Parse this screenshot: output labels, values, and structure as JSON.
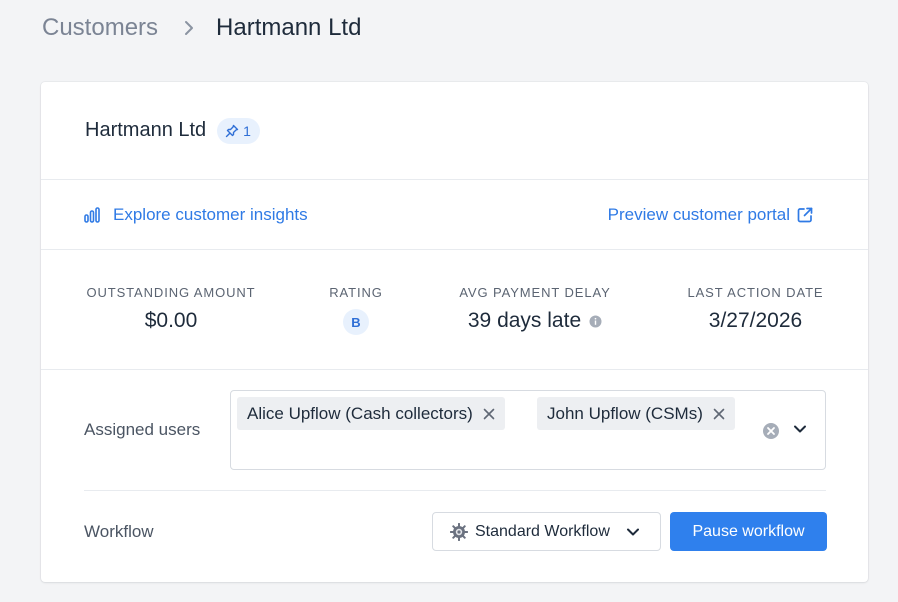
{
  "breadcrumb": {
    "parent": "Customers",
    "current": "Hartmann Ltd"
  },
  "customer": {
    "name": "Hartmann Ltd",
    "pin_count": "1"
  },
  "links": {
    "insights": "Explore customer insights",
    "portal": "Preview customer portal"
  },
  "stats": {
    "outstanding_label": "OUTSTANDING AMOUNT",
    "outstanding_value": "$0.00",
    "rating_label": "RATING",
    "rating_value": "B",
    "delay_label": "AVG PAYMENT DELAY",
    "delay_value": "39 days late",
    "last_action_label": "LAST ACTION DATE",
    "last_action_value": "3/27/2026"
  },
  "assigned": {
    "label": "Assigned users",
    "users": [
      "Alice Upflow (Cash collectors)",
      "John Upflow (CSMs)"
    ]
  },
  "workflow": {
    "label": "Workflow",
    "selected": "Standard Workflow",
    "pause_label": "Pause workflow"
  },
  "colors": {
    "accent": "#2f80ed",
    "link": "#2f7ae5",
    "badge_bg": "#e8f1fd",
    "page_bg": "#f3f4f6"
  },
  "icons": {
    "breadcrumb_separator": "chevron-right-icon",
    "pin": "pin-icon",
    "insights": "bar-chart-icon",
    "portal": "external-link-icon",
    "delay_info": "info-icon",
    "chip_remove": "close-icon",
    "clear": "clear-circle-icon",
    "dropdown": "chevron-down-icon",
    "workflow": "gear-icon"
  }
}
